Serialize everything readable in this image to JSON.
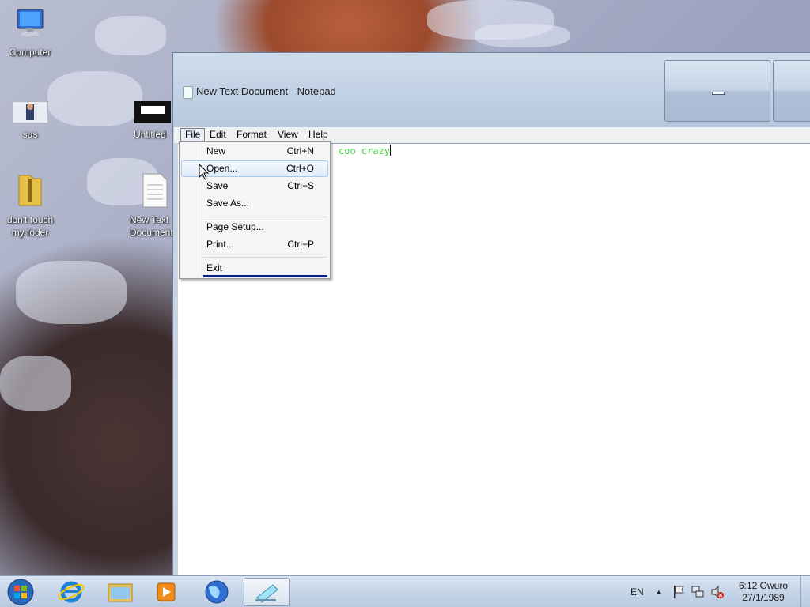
{
  "desktop": {
    "icons": [
      {
        "label": "Computer"
      },
      {
        "label": "sus"
      },
      {
        "label": "Untitled"
      },
      {
        "label": "don't touch my foder"
      },
      {
        "label": "New Text Document"
      }
    ]
  },
  "window": {
    "title": "New Text Document - Notepad",
    "menu": [
      "File",
      "Edit",
      "Format",
      "View",
      "Help"
    ],
    "open_menu": "File",
    "editor_text": "coo crazy"
  },
  "file_menu": {
    "items": [
      {
        "label": "New",
        "shortcut": "Ctrl+N"
      },
      {
        "label": "Open...",
        "shortcut": "Ctrl+O"
      },
      {
        "label": "Save",
        "shortcut": "Ctrl+S"
      },
      {
        "label": "Save As...",
        "shortcut": ""
      },
      {
        "label": "Page Setup...",
        "shortcut": ""
      },
      {
        "label": "Print...",
        "shortcut": "Ctrl+P"
      },
      {
        "label": "Exit",
        "shortcut": ""
      }
    ],
    "highlighted": "Open..."
  },
  "taskbar": {
    "pinned": [
      "start-button",
      "internet-explorer-icon",
      "file-explorer-icon",
      "media-player-icon",
      "globe-icon",
      "notepad-icon"
    ],
    "active": "notepad-icon",
    "language": "EN",
    "time": "6:12 Owuro",
    "date": "27/1/1989"
  },
  "colors": {
    "editor_text": "#41d33c",
    "menu_highlight_border": "#a8c8ec",
    "exit_underline": "#0a1d84"
  }
}
